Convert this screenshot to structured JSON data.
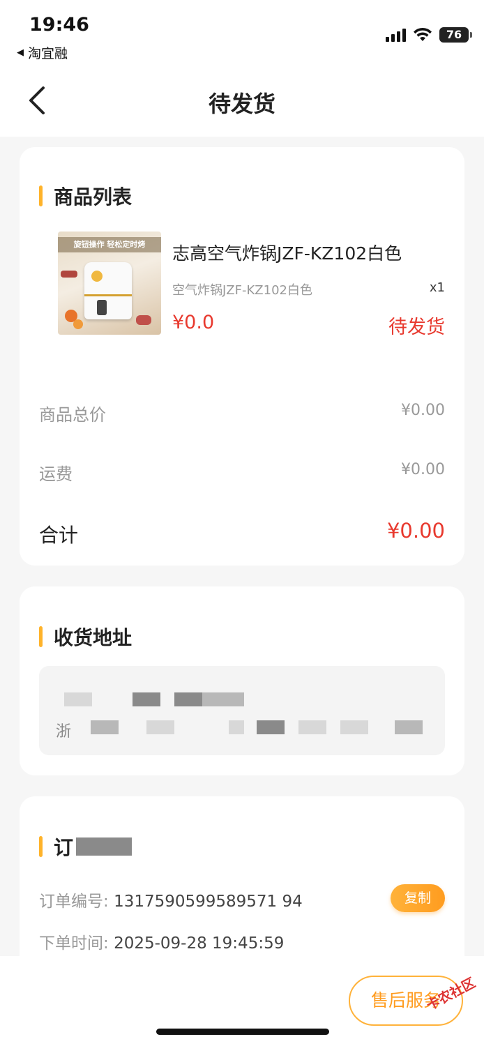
{
  "status_bar": {
    "time": "19:46",
    "back_app": "淘宜融",
    "battery": "76"
  },
  "nav": {
    "title": "待发货"
  },
  "product_section": {
    "title": "商品列表",
    "item": {
      "image_banner": "旋钮操作 轻松定时烤",
      "name": "志高空气炸锅JZF-KZ102白色",
      "spec": "空气炸锅JZF-KZ102白色",
      "qty": "x1",
      "price": "¥0.0",
      "status": "待发货"
    },
    "summary": {
      "subtotal_label": "商品总价",
      "subtotal_value": "¥0.00",
      "shipping_label": "运费",
      "shipping_value": "¥0.00",
      "total_label": "合计",
      "total_value": "¥0.00"
    }
  },
  "address_section": {
    "title": "收货地址",
    "address_prefix": "浙"
  },
  "order_section": {
    "title": "订",
    "order_no_label": "订单编号:",
    "order_no": "1317590599589571 94",
    "copy_label": "复制",
    "time_label": "下单时间:",
    "time": "2025-09-28 19:45:59"
  },
  "bottom": {
    "after_sale_label": "售后服务",
    "watermark": "卡农社区"
  },
  "colors": {
    "accent": "#ffb23a",
    "price_red": "#e8392e"
  }
}
